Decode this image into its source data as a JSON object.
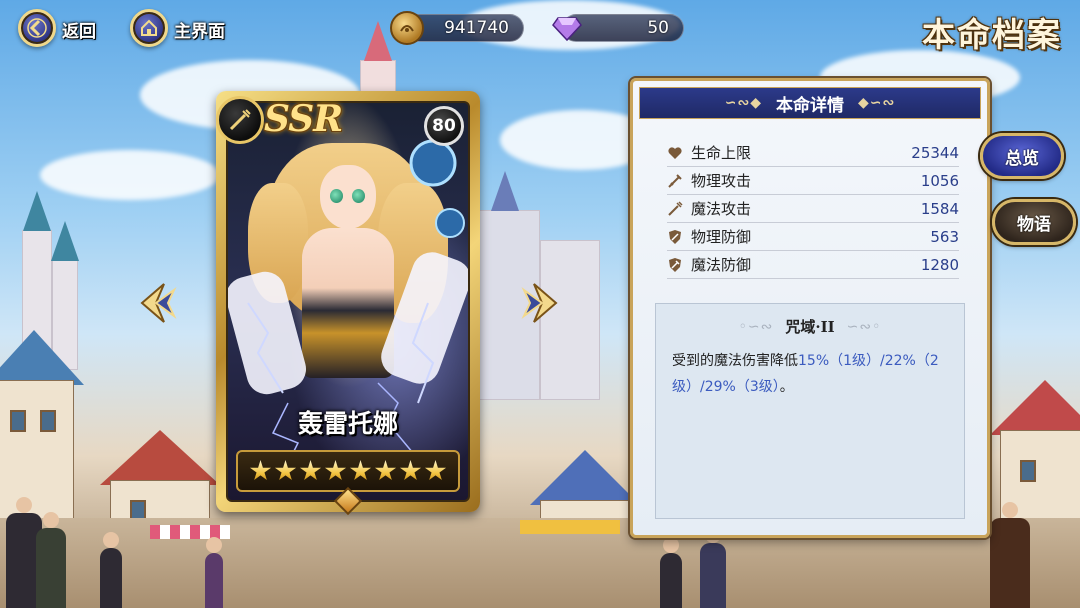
{
  "top_bar": {
    "back_label": "返回",
    "home_label": "主界面",
    "gold_amount": "941740",
    "gem_amount": "50",
    "page_title": "本命档案"
  },
  "card": {
    "rarity": "SSR",
    "level": "80",
    "name": "轰雷托娜",
    "star_count": 8
  },
  "panel": {
    "title": "本命详情",
    "stats": [
      {
        "label": "生命上限",
        "value": "25344",
        "icon": "heart-icon"
      },
      {
        "label": "物理攻击",
        "value": "1056",
        "icon": "sword-icon"
      },
      {
        "label": "魔法攻击",
        "value": "1584",
        "icon": "wand-icon"
      },
      {
        "label": "物理防御",
        "value": "563",
        "icon": "shield-icon"
      },
      {
        "label": "魔法防御",
        "value": "1280",
        "icon": "magic-shield-icon"
      }
    ],
    "skill": {
      "name": "咒域·II",
      "desc_1": "受到的魔法伤害降低",
      "desc_2": "15%（1级）/22%（2级）/29%（3级）",
      "desc_3": "。"
    }
  },
  "tabs": {
    "overview": "总览",
    "story": "物语"
  },
  "colors": {
    "accent_blue": "#2c3a8a",
    "gold_trim": "#c9a45a",
    "highlight_text": "#3b5bbf"
  }
}
